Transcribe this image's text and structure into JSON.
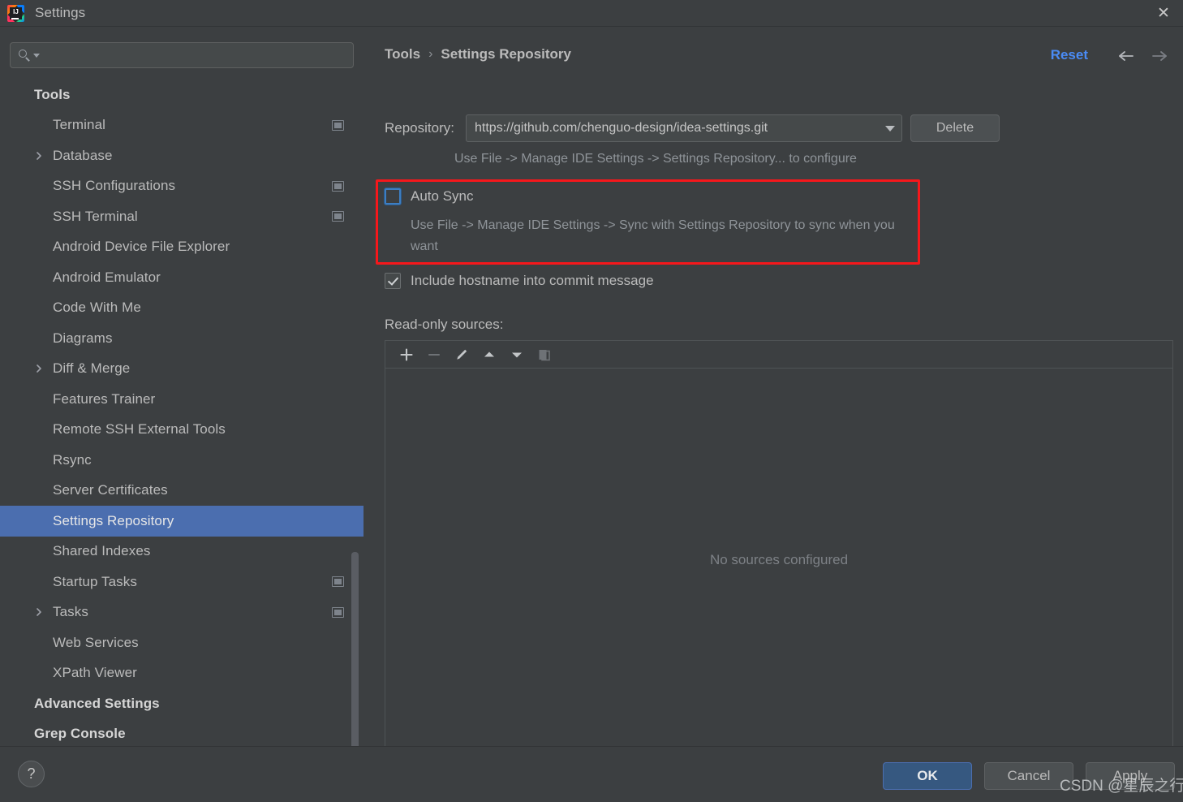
{
  "window": {
    "title": "Settings",
    "logo_icon": "intellij-idea-logo",
    "logo_text": "IJ",
    "close_icon": "close-icon"
  },
  "sidebar": {
    "search": {
      "value": "",
      "placeholder": "",
      "icon": "search-icon"
    },
    "items": [
      {
        "label": "Tools",
        "type": "group",
        "arrow": false,
        "badge": false
      },
      {
        "label": "Terminal",
        "type": "child",
        "arrow": false,
        "badge": true
      },
      {
        "label": "Database",
        "type": "child",
        "arrow": true,
        "badge": false
      },
      {
        "label": "SSH Configurations",
        "type": "child",
        "arrow": false,
        "badge": true
      },
      {
        "label": "SSH Terminal",
        "type": "child",
        "arrow": false,
        "badge": true
      },
      {
        "label": "Android Device File Explorer",
        "type": "child",
        "arrow": false,
        "badge": false
      },
      {
        "label": "Android Emulator",
        "type": "child",
        "arrow": false,
        "badge": false
      },
      {
        "label": "Code With Me",
        "type": "child",
        "arrow": false,
        "badge": false
      },
      {
        "label": "Diagrams",
        "type": "child",
        "arrow": false,
        "badge": false
      },
      {
        "label": "Diff & Merge",
        "type": "child",
        "arrow": true,
        "badge": false
      },
      {
        "label": "Features Trainer",
        "type": "child",
        "arrow": false,
        "badge": false
      },
      {
        "label": "Remote SSH External Tools",
        "type": "child",
        "arrow": false,
        "badge": false
      },
      {
        "label": "Rsync",
        "type": "child",
        "arrow": false,
        "badge": false
      },
      {
        "label": "Server Certificates",
        "type": "child",
        "arrow": false,
        "badge": false
      },
      {
        "label": "Settings Repository",
        "type": "child",
        "arrow": false,
        "badge": false,
        "selected": true
      },
      {
        "label": "Shared Indexes",
        "type": "child",
        "arrow": false,
        "badge": false
      },
      {
        "label": "Startup Tasks",
        "type": "child",
        "arrow": false,
        "badge": true
      },
      {
        "label": "Tasks",
        "type": "child",
        "arrow": true,
        "badge": true
      },
      {
        "label": "Web Services",
        "type": "child",
        "arrow": false,
        "badge": false
      },
      {
        "label": "XPath Viewer",
        "type": "child",
        "arrow": false,
        "badge": false
      },
      {
        "label": "Advanced Settings",
        "type": "group",
        "arrow": false,
        "badge": false
      },
      {
        "label": "Grep Console",
        "type": "group",
        "arrow": false,
        "badge": false
      }
    ],
    "selected": "Settings Repository"
  },
  "main": {
    "breadcrumb": {
      "root": "Tools",
      "separator": "›",
      "current": "Settings Repository"
    },
    "reset_label": "Reset",
    "nav_back_icon": "arrow-left-icon",
    "nav_forward_icon": "arrow-right-icon",
    "repository": {
      "label": "Repository:",
      "value": "https://github.com/chenguo-design/idea-settings.git",
      "delete_label": "Delete",
      "hint": "Use File -> Manage IDE Settings -> Settings Repository... to configure"
    },
    "auto_sync": {
      "label": "Auto Sync",
      "checked": false,
      "description": "Use File -> Manage IDE Settings -> Sync with Settings Repository to sync when you want"
    },
    "include_hostname": {
      "label": "Include hostname into commit message",
      "checked": true
    },
    "read_only_sources": {
      "label": "Read-only sources:",
      "toolbar": [
        {
          "name": "add-icon",
          "label": "Add",
          "disabled": false
        },
        {
          "name": "remove-icon",
          "label": "Remove",
          "disabled": true
        },
        {
          "name": "edit-pencil-icon",
          "label": "Edit",
          "disabled": false
        },
        {
          "name": "move-up-icon",
          "label": "Move Up",
          "disabled": false
        },
        {
          "name": "move-down-icon",
          "label": "Move Down",
          "disabled": false
        },
        {
          "name": "copy-icon",
          "label": "Copy",
          "disabled": true
        }
      ],
      "empty_text": "No sources configured",
      "rows": []
    }
  },
  "footer": {
    "help_label": "?",
    "ok_label": "OK",
    "cancel_label": "Cancel",
    "apply_label": "Apply"
  },
  "watermark": {
    "text": "CSDN @星辰之行"
  },
  "colors": {
    "background": "#3c3f41",
    "selection": "#4b6eaf",
    "accent_link": "#4a8bf5",
    "annotation_red": "#f6171b",
    "ok_button": "#365880",
    "text_primary": "#bbbbbb",
    "text_muted": "#8f9499"
  }
}
